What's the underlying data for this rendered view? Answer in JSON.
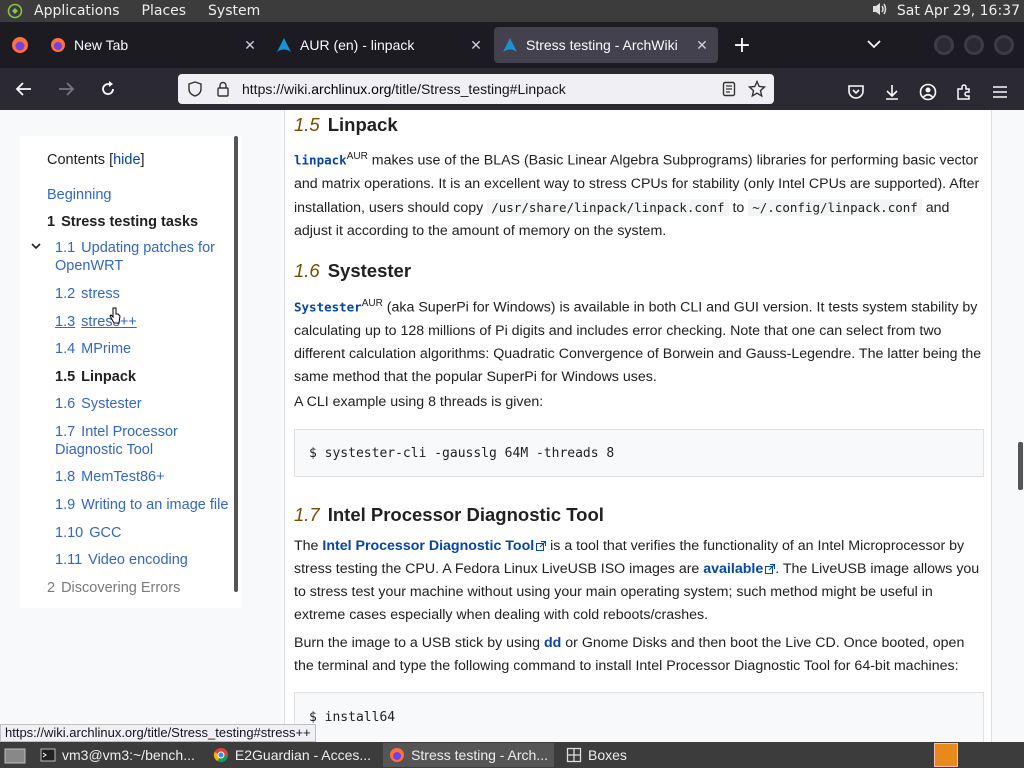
{
  "panel": {
    "menus": [
      "Applications",
      "Places",
      "System"
    ],
    "clock": "Sat Apr 29, 16:37"
  },
  "tabs": [
    {
      "label": "New Tab",
      "icon": "firefox-icon"
    },
    {
      "label": "AUR (en) - linpack",
      "icon": "arch-icon"
    },
    {
      "label": "Stress testing - ArchWiki",
      "icon": "arch-icon",
      "active": true
    }
  ],
  "nav": {
    "url_prefix": "https://wiki.",
    "url_domain": "archlinux.org",
    "url_suffix": "/title/Stress_testing#Linpack"
  },
  "toc": {
    "title": "Contents",
    "hide_label": "hide",
    "items": [
      {
        "label": "Beginning"
      },
      {
        "num": "1",
        "label": "Stress testing tasks"
      },
      {
        "num": "1.1",
        "label": "Updating patches for"
      },
      {
        "label": "OpenWRT"
      },
      {
        "num": "1.2",
        "label": "stress"
      },
      {
        "num": "1.3",
        "label": "stress++"
      },
      {
        "num": "1.4",
        "label": "MPrime"
      },
      {
        "num": "1.5",
        "label": "Linpack"
      },
      {
        "num": "1.6",
        "label": "Systester"
      },
      {
        "num": "1.7",
        "label": "Intel Processor"
      },
      {
        "label": "Diagnostic Tool"
      },
      {
        "num": "1.8",
        "label": "MemTest86+"
      },
      {
        "num": "1.9",
        "label": "Writing to an image file"
      },
      {
        "num": "1.10",
        "label": "GCC"
      },
      {
        "num": "1.11",
        "label": "Video encoding"
      },
      {
        "num": "2",
        "label": "Discovering Errors"
      }
    ]
  },
  "article": {
    "s15": {
      "num": "1.5",
      "title": "Linpack",
      "pkg": "linpack",
      "sup": "AUR",
      "t1": " makes use of the BLAS (Basic Linear Algebra Subprograms) libraries for performing basic vector and matrix operations. It is an excellent way to stress CPUs for stability (only Intel CPUs are supported). After installation, users should copy ",
      "code1": "/usr/share/linpack/linpack.conf",
      "t2": " to ",
      "code2": "~/.config/linpack.conf",
      "t3": " and adjust it according to the amount of memory on the system."
    },
    "s16": {
      "num": "1.6",
      "title": "Systester",
      "pkg": "Systester",
      "sup": "AUR",
      "t1": " (aka SuperPi for Windows) is available in both CLI and GUI version. It tests system stability by calculating up to 128 millions of Pi digits and includes error checking. Note that one can select from two different calculation algorithms: Quadratic Convergence of Borwein and Gauss-Legendre. The latter being the same method that the popular SuperPi for Windows uses.",
      "p2": "A CLI example using 8 threads is given:",
      "cmd": "$ systester-cli -gausslg 64M -threads 8"
    },
    "s17": {
      "num": "1.7",
      "title": "Intel Processor Diagnostic Tool",
      "t0": "The ",
      "link1": "Intel Processor Diagnostic Tool",
      "t1": " is a tool that verifies the functionality of an Intel Microprocessor by stress testing the CPU. A Fedora Linux LiveUSB ISO images are ",
      "link2": "available",
      "t2": ". The LiveUSB image allows you to stress test your machine without using your main operating system; such method might be useful in extreme cases especially when dealing with cold reboots/crashes.",
      "p2a": "Burn the image to a USB stick by using ",
      "link3": "dd",
      "p2b": " or Gnome Disks and then boot the Live CD. Once booted, open the terminal and type the following command to install Intel Processor Diagnostic Tool for 64-bit machines:",
      "cmd": "$ install64"
    }
  },
  "status_link": "https://wiki.archlinux.org/title/Stress_testing#stress++",
  "taskbar": [
    {
      "label": "vm3@vm3:~/bench...",
      "icon": "terminal-icon"
    },
    {
      "label": "E2Guardian - Acces...",
      "icon": "chrome-icon"
    },
    {
      "label": "Stress testing - Arch...",
      "icon": "firefox-icon",
      "active": true
    },
    {
      "label": "Boxes",
      "icon": "boxes-icon"
    }
  ]
}
